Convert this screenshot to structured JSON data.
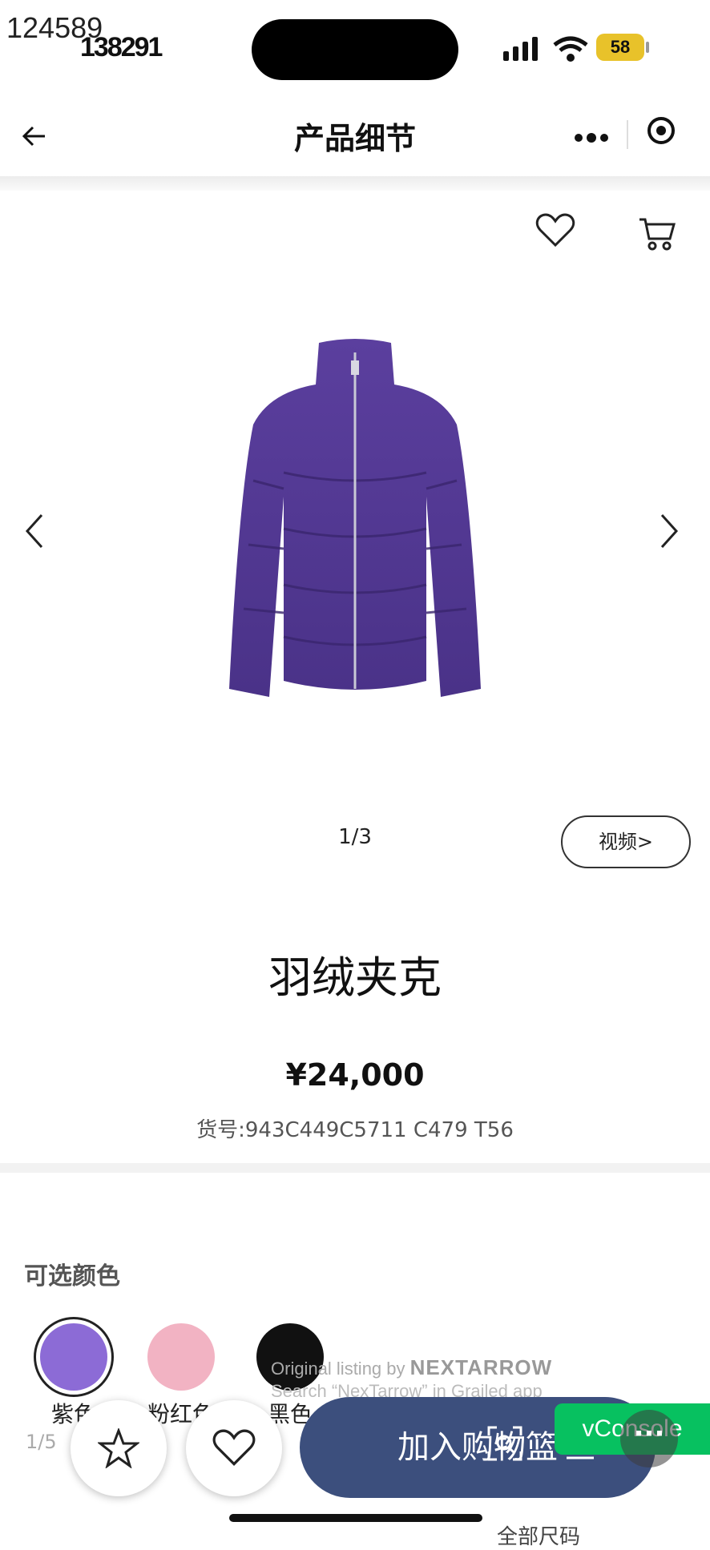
{
  "status": {
    "corner_id": "124589",
    "time": "138291",
    "battery": "58"
  },
  "nav": {
    "title": "产品细节"
  },
  "gallery": {
    "pager": "1/3",
    "video_label": "视频>"
  },
  "product": {
    "name": "羽绒夹克",
    "price": "¥24,000",
    "sku": "货号:943C449C5711 C479 T56",
    "image_color": "#5a3d9a"
  },
  "colors": {
    "title": "可选颜色",
    "options": [
      {
        "label": "紫色",
        "hex": "#8c6bd6"
      },
      {
        "label": "粉红色",
        "hex": "#f2b3c3"
      },
      {
        "label": "黑色",
        "hex": "#111111"
      }
    ],
    "page_indicator": "1/5"
  },
  "watermark": {
    "line1": "Original listing by",
    "brand": "NEXTARROW",
    "line2": "Search “NexTarrow” in Grailed app"
  },
  "bottom_bar": {
    "add_to_cart": "加入购物篮",
    "accent": "#3c4f7d",
    "vconsole": "vConsole",
    "all_sizes": "全部尺码"
  }
}
